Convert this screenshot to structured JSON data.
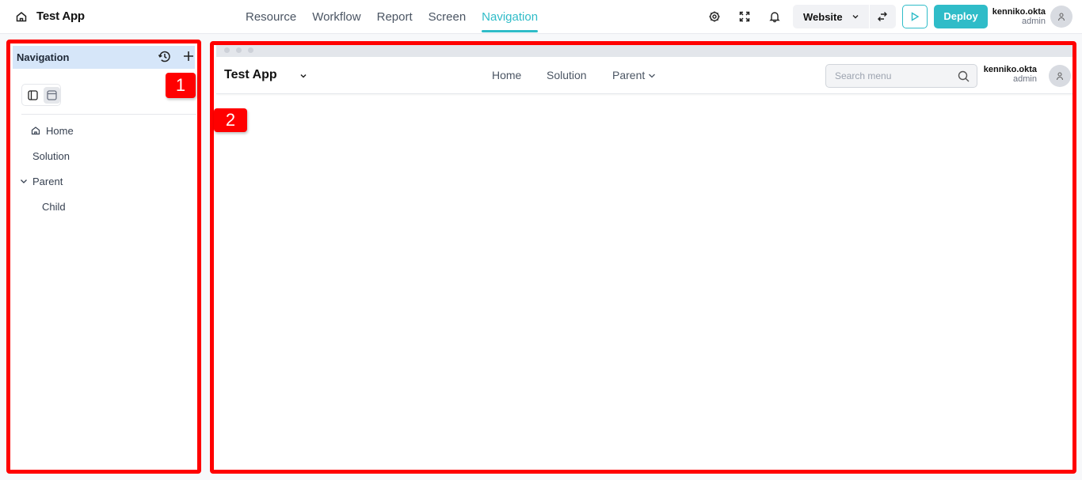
{
  "app": {
    "title": "Test App",
    "home_icon": "home-icon"
  },
  "tabs": [
    {
      "label": "Resource",
      "active": false
    },
    {
      "label": "Workflow",
      "active": false
    },
    {
      "label": "Report",
      "active": false
    },
    {
      "label": "Screen",
      "active": false
    },
    {
      "label": "Navigation",
      "active": true
    }
  ],
  "toolbar": {
    "icons": [
      "settings-icon",
      "fullscreen-icon",
      "bell-icon"
    ],
    "mode_select": {
      "value": "Website"
    },
    "swap_icon": "swap-icon",
    "preview_icon": "play-icon",
    "deploy_label": "Deploy",
    "accent_color": "#2fbcc8"
  },
  "user": {
    "name": "kenniko.okta",
    "role": "admin"
  },
  "navigation_panel": {
    "title": "Navigation",
    "badge": "1",
    "layout_options": [
      "sidebar-layout",
      "topbar-layout"
    ],
    "layout_selected": "topbar-layout",
    "items": [
      {
        "label": "Home",
        "icon": "home-icon",
        "level": 0
      },
      {
        "label": "Solution",
        "level": 0
      },
      {
        "label": "Parent",
        "level": 0,
        "expanded": true
      },
      {
        "label": "Child",
        "level": 1
      }
    ]
  },
  "preview": {
    "badge": "2",
    "app_title": "Test App",
    "nav_links": [
      {
        "label": "Home"
      },
      {
        "label": "Solution"
      },
      {
        "label": "Parent",
        "has_dropdown": true
      }
    ],
    "search": {
      "placeholder": "Search menu",
      "value": ""
    },
    "user": {
      "name": "kenniko.okta",
      "role": "admin"
    }
  }
}
